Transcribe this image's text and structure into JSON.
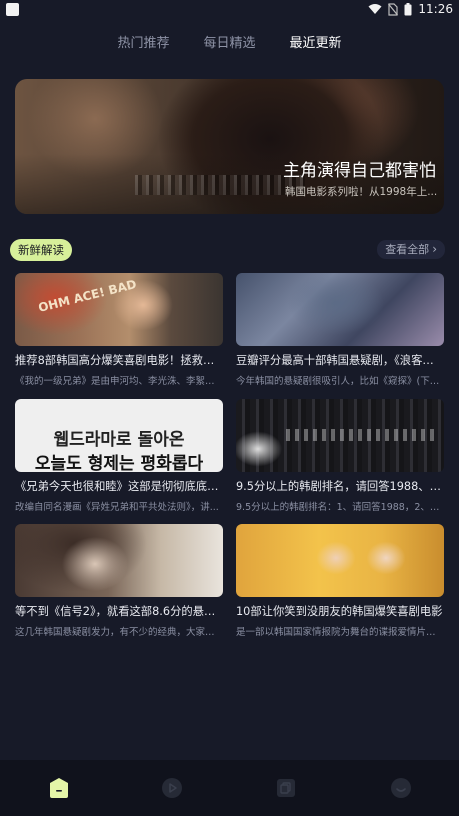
{
  "status_bar": {
    "time": "11:26"
  },
  "tabs": [
    {
      "label": "热门推荐",
      "active": false
    },
    {
      "label": "每日精选",
      "active": false
    },
    {
      "label": "最近更新",
      "active": true
    }
  ],
  "banner": {
    "title": "主角演得自己都害怕",
    "subtitle": "韩国电影系列啦！从1998年上..."
  },
  "section": {
    "badge": "新鲜解读",
    "view_all": "查看全部"
  },
  "cards": [
    {
      "title": "推荐8部韩国高分爆笑喜剧电影！拯救你的...",
      "desc": "《我的一级兄弟》是由申河均、李光洙、李絮主...",
      "thumb_text": "OHM ACE! BAD"
    },
    {
      "title": "豆瓣评分最高十部韩国悬疑剧，《浪客行...",
      "desc": "今年韩国的悬疑剧很吸引人，比如《窥探》(下周..."
    },
    {
      "title": "《兄弟今天也很和睦》这部是彻彻底底的...",
      "desc": "改编自同名漫画《异姓兄弟和平共处法则》，讲...",
      "thumb_small": "웹드라마로 돌아온",
      "thumb_l1": "웹드라마로 돌아온",
      "thumb_l2": "오늘도 형제는 평화롭다"
    },
    {
      "title": "9.5分以上的韩剧排名，请回答1988、搞笑...",
      "desc": "9.5分以上的韩剧排名：1、请回答1988，2、搞笑..."
    },
    {
      "title": "等不到《信号2》，就看这部8.6分的悬疑...",
      "desc": "这几年韩国悬疑剧发力，有不少的经典，大家各..."
    },
    {
      "title": "10部让你笑到没朋友的韩国爆笑喜剧电影",
      "desc": "是一部以韩国国家情报院为舞台的谍报爱情片，\"..."
    }
  ],
  "bottom_nav": [
    {
      "icon": "home-icon",
      "active": true
    },
    {
      "icon": "play-icon",
      "active": false
    },
    {
      "icon": "copy-icon",
      "active": false
    },
    {
      "icon": "profile-icon",
      "active": false
    }
  ],
  "colors": {
    "background": "#171a28",
    "accent": "#d7f09a",
    "bottom_nav": "#10121c"
  }
}
